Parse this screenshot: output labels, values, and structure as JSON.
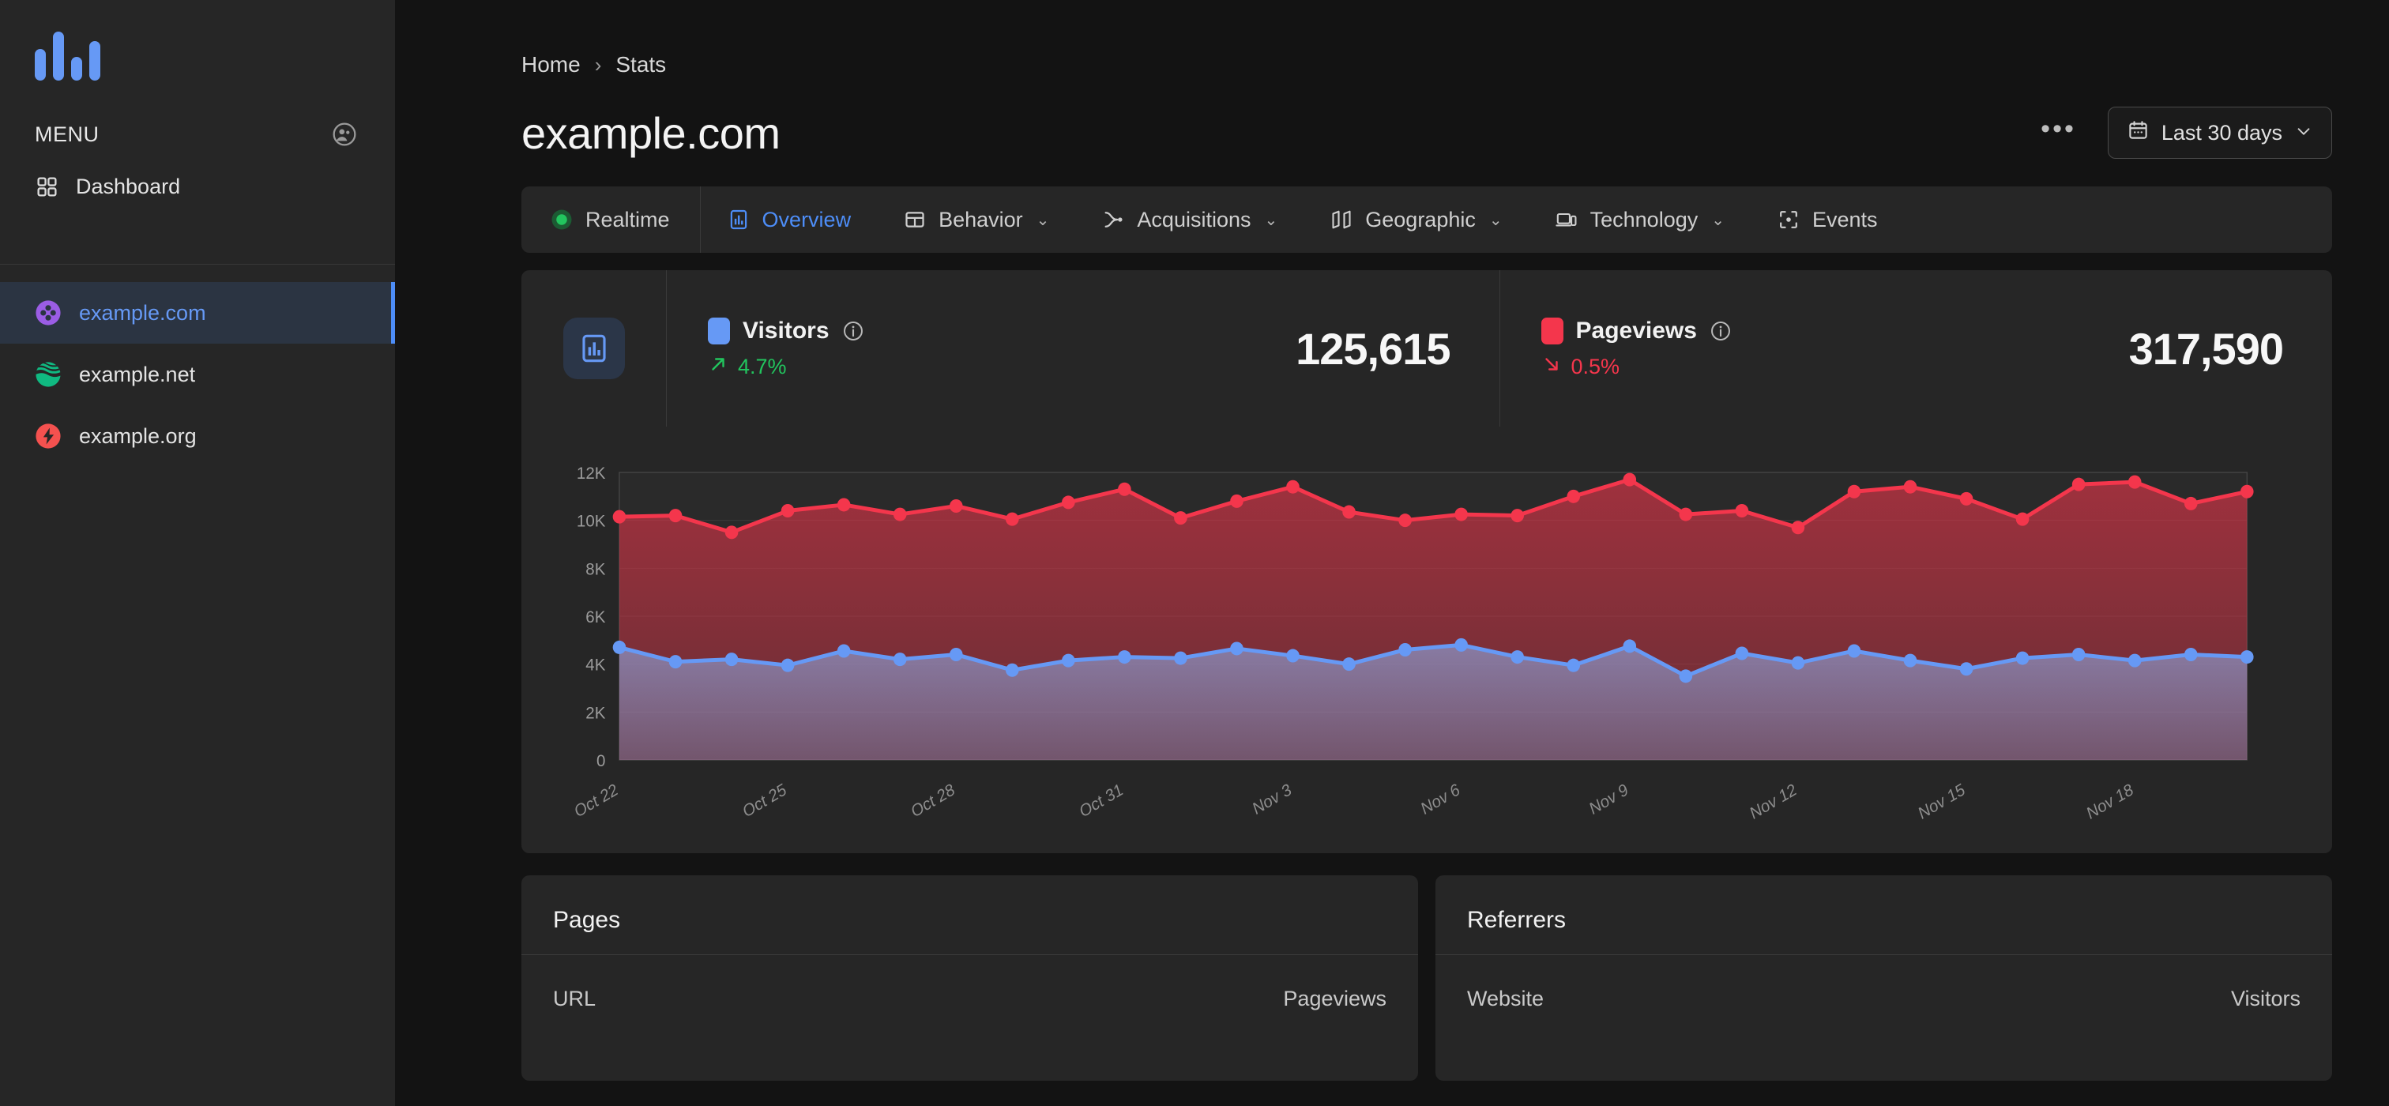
{
  "sidebar": {
    "logo_name": "analytics-bars-logo",
    "menu_label": "MENU",
    "avatar_icon": "user-avatar-icon",
    "nav": [
      {
        "label": "Dashboard",
        "icon": "grid-icon"
      }
    ],
    "sites": [
      {
        "label": "example.com",
        "icon": "clover-circle-icon",
        "color": "#9b5de5",
        "active": true
      },
      {
        "label": "example.net",
        "icon": "waves-circle-icon",
        "color": "#10b981",
        "active": false
      },
      {
        "label": "example.org",
        "icon": "bolt-circle-icon",
        "color": "#f4514f",
        "active": false
      }
    ]
  },
  "header": {
    "breadcrumb": {
      "home": "Home",
      "separator": "›",
      "current": "Stats"
    },
    "title": "example.com",
    "more_label": "•••",
    "date_range": {
      "label": "Last 30 days",
      "icon": "calendar-icon",
      "chevron": "⌄"
    }
  },
  "tabs": [
    {
      "label": "Realtime",
      "icon": "live-dot-icon",
      "chevron": "",
      "active": false
    },
    {
      "label": "Overview",
      "icon": "bar-chart-icon",
      "chevron": "",
      "active": true
    },
    {
      "label": "Behavior",
      "icon": "layout-icon",
      "chevron": "⌄",
      "active": false
    },
    {
      "label": "Acquisitions",
      "icon": "branch-icon",
      "chevron": "⌄",
      "active": false
    },
    {
      "label": "Geographic",
      "icon": "map-icon",
      "chevron": "⌄",
      "active": false
    },
    {
      "label": "Technology",
      "icon": "devices-icon",
      "chevron": "⌄",
      "active": false
    },
    {
      "label": "Events",
      "icon": "target-icon",
      "chevron": "",
      "active": false
    }
  ],
  "metrics": {
    "card_icon": "chart-badge-icon",
    "visitors": {
      "label": "Visitors",
      "value": "125,615",
      "delta": "4.7%",
      "delta_direction": "up",
      "color": "#6699f5",
      "delta_color": "#22c55e",
      "info_icon": "info-icon"
    },
    "pageviews": {
      "label": "Pageviews",
      "value": "317,590",
      "delta": "0.5%",
      "delta_direction": "down",
      "color": "#f4364c",
      "delta_color": "#f4364c",
      "info_icon": "info-icon"
    }
  },
  "chart_data": {
    "type": "area",
    "title": "",
    "xlabel": "",
    "ylabel": "",
    "ylim": [
      0,
      12000
    ],
    "yticks": [
      0,
      2000,
      4000,
      6000,
      8000,
      10000,
      12000
    ],
    "ytick_labels": [
      "0",
      "2K",
      "4K",
      "6K",
      "8K",
      "10K",
      "12K"
    ],
    "grid": true,
    "legend_position": "top-cards",
    "x": [
      "Oct 22",
      "Oct 23",
      "Oct 24",
      "Oct 25",
      "Oct 26",
      "Oct 27",
      "Oct 28",
      "Oct 29",
      "Oct 30",
      "Oct 31",
      "Nov 1",
      "Nov 2",
      "Nov 3",
      "Nov 4",
      "Nov 5",
      "Nov 6",
      "Nov 7",
      "Nov 8",
      "Nov 9",
      "Nov 10",
      "Nov 11",
      "Nov 12",
      "Nov 13",
      "Nov 14",
      "Nov 15",
      "Nov 16",
      "Nov 17",
      "Nov 18",
      "Nov 19",
      "Nov 20"
    ],
    "xtick_labels": [
      "Oct 22",
      "Oct 25",
      "Oct 28",
      "Oct 31",
      "Nov 3",
      "Nov 6",
      "Nov 9",
      "Nov 12",
      "Nov 15",
      "Nov 18"
    ],
    "xtick_indices": [
      0,
      3,
      6,
      9,
      12,
      15,
      18,
      21,
      24,
      27
    ],
    "xtick_rotation": -30,
    "series": [
      {
        "name": "Pageviews",
        "color": "#f4364c",
        "values": [
          10150,
          10200,
          9500,
          10400,
          10650,
          10250,
          10600,
          10050,
          10750,
          11300,
          10100,
          10800,
          11400,
          10350,
          10000,
          10250,
          10200,
          11000,
          11700,
          10250,
          10400,
          9700,
          11200,
          11400,
          10900,
          10050,
          11500,
          11600,
          10700,
          11200
        ]
      },
      {
        "name": "Visitors",
        "color": "#6699f5",
        "values": [
          4700,
          4100,
          4200,
          3950,
          4550,
          4200,
          4400,
          3750,
          4150,
          4300,
          4250,
          4650,
          4350,
          4000,
          4600,
          4800,
          4300,
          3950,
          4750,
          3500,
          4450,
          4050,
          4550,
          4150,
          3800,
          4250,
          4400,
          4150,
          4400,
          4300
        ]
      }
    ]
  },
  "panels": [
    {
      "title": "Pages",
      "col_left": "URL",
      "col_right": "Pageviews"
    },
    {
      "title": "Referrers",
      "col_left": "Website",
      "col_right": "Visitors"
    }
  ]
}
